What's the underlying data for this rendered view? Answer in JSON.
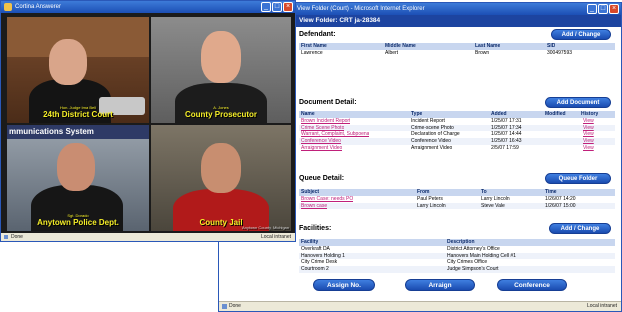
{
  "video_window": {
    "title": "Cortina Answerer",
    "status_left": "Done",
    "status_right": "Local intranet",
    "feeds": [
      {
        "sub": "Hon. Judge Ima Bell",
        "label": "24th District Court"
      },
      {
        "sub": "A. Jones",
        "label": "County Prosecutor"
      },
      {
        "sub": "Sgt. Dorado",
        "label": "Anytown Police Dept."
      },
      {
        "sub": "",
        "label": "County Jail",
        "footer": "Anytown County, Michigan"
      }
    ],
    "banner_text": "mmunications System"
  },
  "ie_window": {
    "title": "View Folder (Court) - Microsoft Internet Explorer",
    "banner": "View Folder: CRT ja-28384",
    "status_left": "Done",
    "status_right": "Local intranet"
  },
  "defendant": {
    "title": "Defendant:",
    "button": "Add / Change",
    "headers": [
      "First Name",
      "Middle Name",
      "Last Name",
      "SID"
    ],
    "row": [
      "Lawrence",
      "Albert",
      "Brown",
      "300497593"
    ]
  },
  "documents": {
    "title": "Document Detail:",
    "button": "Add Document",
    "headers": [
      "Name",
      "Type",
      "Added",
      "Modified",
      "History"
    ],
    "rows": [
      [
        "Brown Incident Report",
        "Incident Report",
        "1/25/07 17:31",
        "",
        "View"
      ],
      [
        "Crime Scene Photo",
        "Crime-scene Photo",
        "1/25/07 17:34",
        "",
        "View"
      ],
      [
        "Warrant, Complaint, Subpoena",
        "Declaration of Charge",
        "1/25/07 14:44",
        "",
        "View"
      ],
      [
        "Conference Video",
        "Conference Video",
        "1/25/07 16:43",
        "",
        "View"
      ],
      [
        "Arraignment Video",
        "Arraignment Video",
        "2/5/07 17:59",
        "",
        "View"
      ]
    ]
  },
  "queue": {
    "title": "Queue Detail:",
    "button": "Queue Folder",
    "headers": [
      "Subject",
      "From",
      "To",
      "Time"
    ],
    "rows": [
      [
        "Brown Case: needs PO",
        "Paul Peters",
        "Larry Lincoln",
        "1/26/07 14:20"
      ],
      [
        "Brown case",
        "Larry Lincoln",
        "Steve Vale",
        "1/26/07 15:00"
      ]
    ]
  },
  "facilities": {
    "title": "Facilities:",
    "button": "Add / Change",
    "headers": [
      "Facility",
      "Description"
    ],
    "rows": [
      [
        "Overkraft DA",
        "District Attorney's Office"
      ],
      [
        "Hanovers Holding 1",
        "Hanovers Main Holding Cell #1"
      ],
      [
        "City Crime Desk",
        "City Crimes Office"
      ],
      [
        "Courtroom 2",
        "Judge Simpson's Court"
      ]
    ]
  },
  "actions": {
    "assign": "Assign No.",
    "arraign": "Arraign",
    "conference": "Conference"
  },
  "colors": {
    "accent": "#1a4bb0",
    "banner": "#1d44a0",
    "link": "#c0207a",
    "label_yellow": "#f5ee28"
  }
}
